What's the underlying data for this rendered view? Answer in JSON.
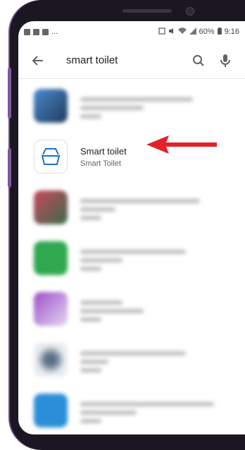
{
  "status_bar": {
    "left_dots": "...",
    "battery_percent": "60%",
    "time": "9:16"
  },
  "search": {
    "query": "smart toilet",
    "back_icon": "arrow-back-icon",
    "search_icon": "search-icon",
    "mic_icon": "mic-icon"
  },
  "results": {
    "highlighted": {
      "title": "Smart toilet",
      "developer": "Smart Toilet"
    }
  },
  "colors": {
    "arrow": "#e52027",
    "device_frame": "#1b1722",
    "device_accent": "#7a5a9c"
  }
}
